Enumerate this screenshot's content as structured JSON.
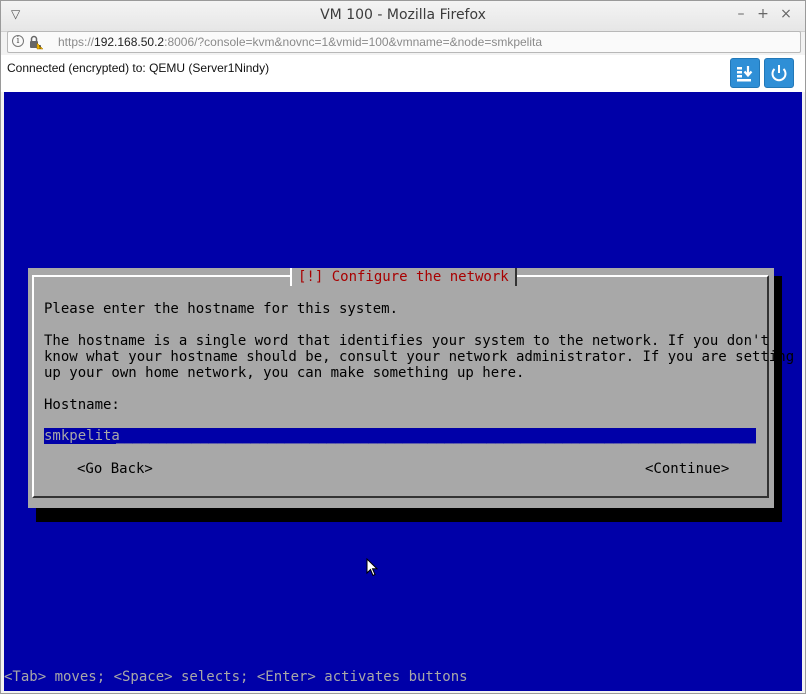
{
  "window": {
    "title": "VM 100 - Mozilla Firefox",
    "menu_glyph": "▽",
    "minimize_glyph": "–",
    "maximize_glyph": "+",
    "close_glyph": "×"
  },
  "urlbar": {
    "scheme": "https://",
    "host": "192.168.50.2",
    "rest": ":8006/?console=kvm&novnc=1&vmid=100&vmname=&node=smkpelita",
    "info_glyph": "i"
  },
  "vnc": {
    "status": "Connected (encrypted) to: QEMU (Server1Nindy)",
    "buttons": [
      "send-keys",
      "power"
    ]
  },
  "dialog": {
    "title": "[!] Configure the network",
    "prompt": "Please enter the hostname for this system.",
    "description_lines": [
      "The hostname is a single word that identifies your system to the network. If you don't",
      "know what your hostname should be, consult your network administrator. If you are setting",
      "up your own home network, you can make something up here."
    ],
    "field_label": "Hostname:",
    "hostname_value": "smkpelita",
    "go_back_label": "<Go Back>",
    "continue_label": "<Continue>"
  },
  "help_line": "<Tab> moves; <Space> selects; <Enter> activates buttons",
  "colors": {
    "console_bg": "#0000a8",
    "dialog_bg": "#a8a8a8",
    "title_red": "#a80000",
    "vnc_button": "#2f8fd6"
  }
}
